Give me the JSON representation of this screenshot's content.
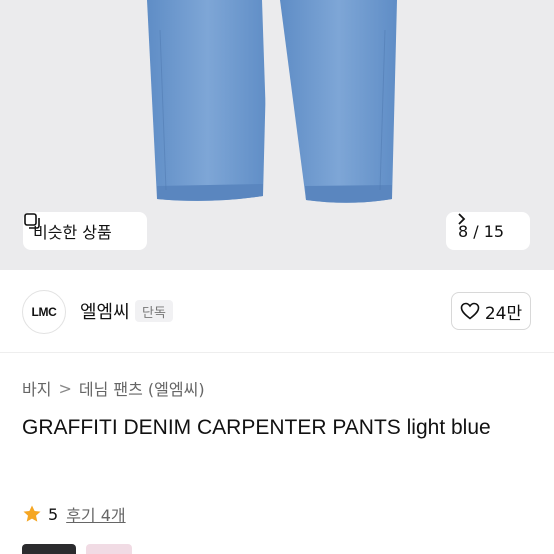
{
  "gallery": {
    "similar_label": "비슷한 상품",
    "counter": "8 / 15",
    "icon_similar": "stacked-squares-icon",
    "icon_next": "chevron-right-icon"
  },
  "shop": {
    "logo_text": "LMC",
    "name": "엘엠씨",
    "badge": "단독",
    "likes": "24만",
    "icon_like": "heart-outline-icon"
  },
  "breadcrumb": {
    "items": [
      "바지",
      "데님 팬츠 (엘엠씨)"
    ],
    "separator": ">"
  },
  "product": {
    "title": "GRAFFITI DENIM CARPENTER PANTS light blue"
  },
  "rating": {
    "score": "5",
    "reviews": "후기 4개",
    "star_color": "#f5a623"
  },
  "colors": {
    "denim": "#6f9bcf",
    "background": "#ebebed"
  }
}
